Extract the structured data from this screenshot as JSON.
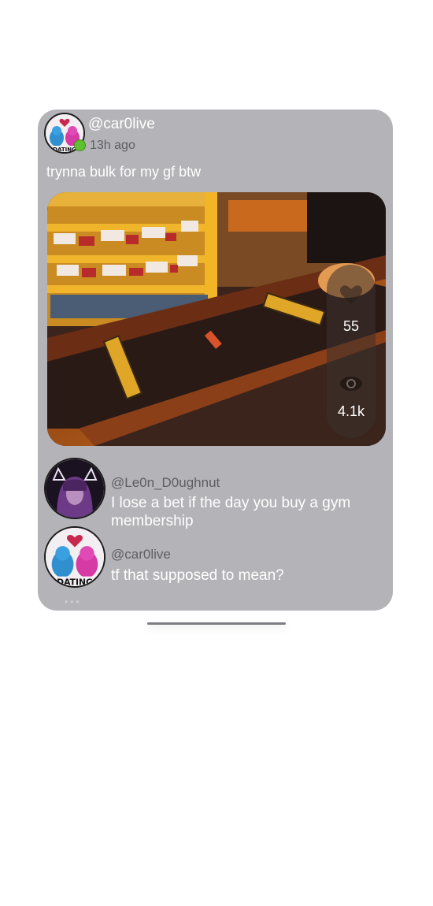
{
  "post": {
    "username": "@car0live",
    "timestamp": "13h ago",
    "caption": "trynna bulk for my gf btw",
    "author_avatar_icon": "dating-penguins-avatar",
    "online_status": "online",
    "stats": {
      "likes": "55",
      "views": "4.1k",
      "like_icon": "heart-icon",
      "view_icon": "eye-icon"
    }
  },
  "comments": [
    {
      "username": "@Le0n_D0ughnut",
      "text": "I lose a bet if the day you buy a gym membership",
      "avatar_icon": "cat-ears-girl-avatar"
    },
    {
      "username": "@car0live",
      "text": "tf that supposed to mean?",
      "avatar_icon": "dating-penguins-avatar"
    }
  ],
  "colors": {
    "card_bg": "#b4b3b8",
    "muted_text": "#5e5e63",
    "online": "#5fc12f"
  }
}
